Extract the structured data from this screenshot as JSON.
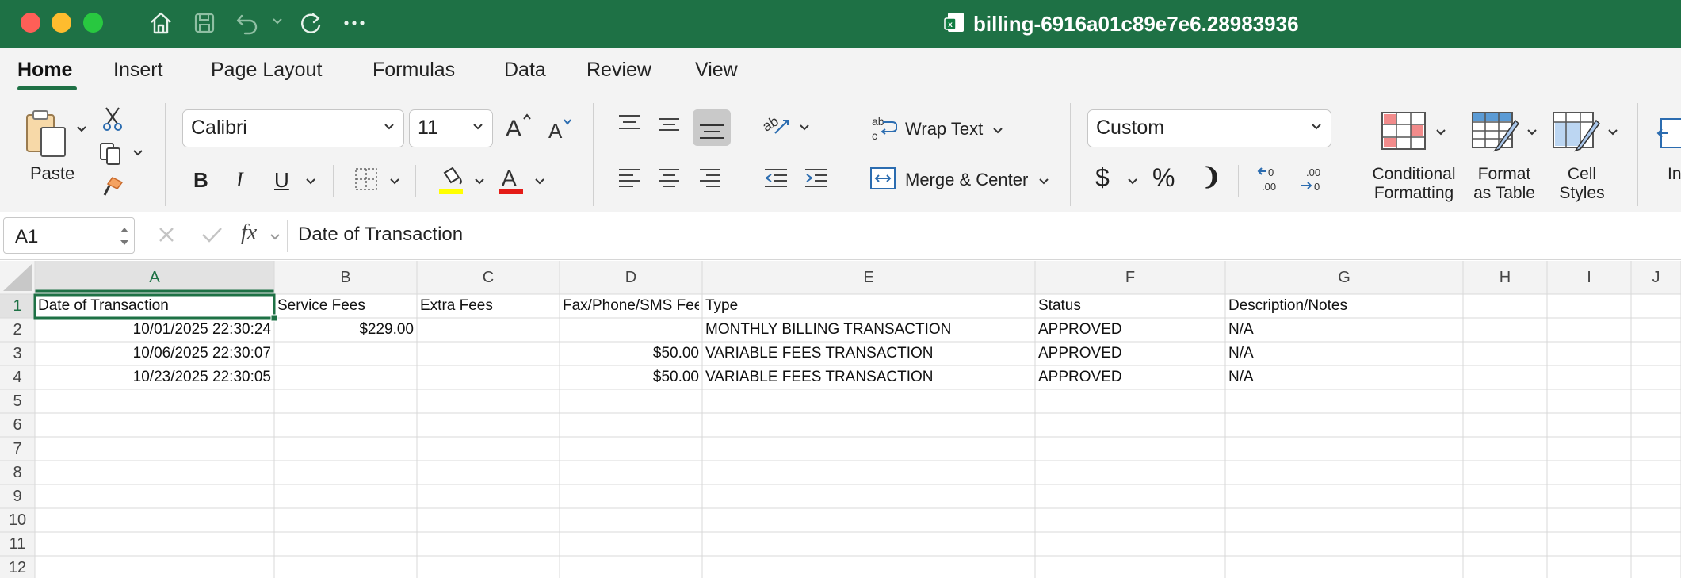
{
  "window": {
    "title": "billing-6916a01c89e7e6.28983936",
    "colors": {
      "titlebar": "#1e7145",
      "accent": "#1e7145"
    }
  },
  "tabs": [
    "Home",
    "Insert",
    "Page Layout",
    "Formulas",
    "Data",
    "Review",
    "View"
  ],
  "active_tab": "Home",
  "ribbon": {
    "paste_label": "Paste",
    "font_name": "Calibri",
    "font_size": "11",
    "bold": "B",
    "italic": "I",
    "underline": "U",
    "wrap_text": "Wrap Text",
    "merge_center": "Merge & Center",
    "number_format": "Custom",
    "currency_symbol": "$",
    "percent_symbol": "%",
    "comma_symbol": "❩",
    "conditional_formatting": [
      "Conditional",
      "Formatting"
    ],
    "format_as_table": [
      "Format",
      "as Table"
    ],
    "cell_styles": [
      "Cell",
      "Styles"
    ],
    "insert_partial": "In"
  },
  "formula_bar": {
    "name_box": "A1",
    "fx": "fx",
    "content": "Date of Transaction"
  },
  "grid": {
    "columns": [
      "A",
      "B",
      "C",
      "D",
      "E",
      "F",
      "G",
      "H",
      "I",
      "J"
    ],
    "rows": [
      "1",
      "2",
      "3",
      "4",
      "5",
      "6",
      "7",
      "8",
      "9",
      "10",
      "11",
      "12"
    ],
    "selected_cell": "A1",
    "header_row": [
      "Date of Transaction",
      "Service Fees",
      "Extra Fees",
      "Fax/Phone/SMS Fee",
      "Type",
      "Status",
      "Description/Notes"
    ],
    "data_rows": [
      [
        "10/01/2025 22:30:24",
        "$229.00",
        "",
        "",
        "MONTHLY BILLING TRANSACTION",
        "APPROVED",
        "N/A"
      ],
      [
        "10/06/2025 22:30:07",
        "",
        "",
        "$50.00",
        "VARIABLE FEES TRANSACTION",
        "APPROVED",
        "N/A"
      ],
      [
        "10/23/2025 22:30:05",
        "",
        "",
        "$50.00",
        "VARIABLE FEES TRANSACTION",
        "APPROVED",
        "N/A"
      ]
    ]
  }
}
